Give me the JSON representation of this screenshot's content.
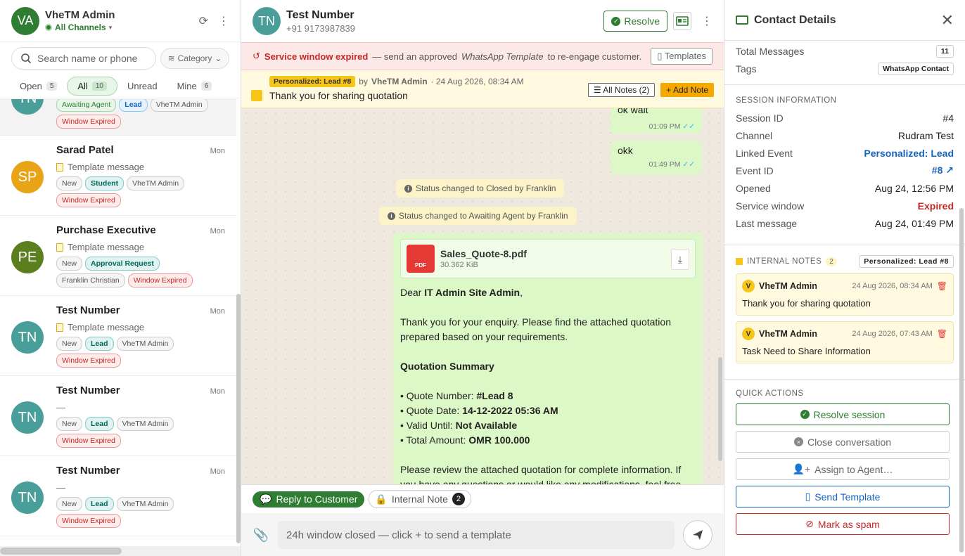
{
  "user": {
    "initials": "VA",
    "name": "VheTM Admin",
    "channel": "All Channels"
  },
  "search": {
    "placeholder": "Search name or phone",
    "category": "Category"
  },
  "tabs": [
    {
      "label": "Open",
      "count": "5"
    },
    {
      "label": "All",
      "count": "10"
    },
    {
      "label": "Unread",
      "count": ""
    },
    {
      "label": "Mine",
      "count": "6"
    }
  ],
  "conversations": [
    {
      "initials": "TN",
      "color": "#4a9e9a",
      "name": "",
      "time": "",
      "preview": "",
      "chips": [
        {
          "t": "Awaiting Agent"
        },
        {
          "t": "Lead"
        },
        {
          "t": "VheTM Admin"
        },
        {
          "t": "Window Expired"
        }
      ]
    },
    {
      "initials": "SP",
      "color": "#e8a317",
      "name": "Sarad Patel",
      "time": "Mon",
      "preview": "Template message",
      "chips": [
        {
          "t": "New"
        },
        {
          "t": "Student"
        },
        {
          "t": "VheTM Admin"
        },
        {
          "t": "Window Expired"
        }
      ]
    },
    {
      "initials": "PE",
      "color": "#5b7f1e",
      "name": "Purchase Executive",
      "time": "Mon",
      "preview": "Template message",
      "chips": [
        {
          "t": "New"
        },
        {
          "t": "Approval Request"
        },
        {
          "t": "Franklin Christian"
        },
        {
          "t": "Window Expired"
        }
      ]
    },
    {
      "initials": "TN",
      "color": "#4a9e9a",
      "name": "Test Number",
      "time": "Mon",
      "preview": "Template message",
      "chips": [
        {
          "t": "New"
        },
        {
          "t": "Lead"
        },
        {
          "t": "VheTM Admin"
        },
        {
          "t": "Window Expired"
        }
      ]
    },
    {
      "initials": "TN",
      "color": "#4a9e9a",
      "name": "Test Number",
      "time": "Mon",
      "preview": "—",
      "chips": [
        {
          "t": "New"
        },
        {
          "t": "Lead"
        },
        {
          "t": "VheTM Admin"
        },
        {
          "t": "Window Expired"
        }
      ]
    },
    {
      "initials": "TN",
      "color": "#4a9e9a",
      "name": "Test Number",
      "time": "Mon",
      "preview": "—",
      "chips": [
        {
          "t": "New"
        },
        {
          "t": "Lead"
        },
        {
          "t": "VheTM Admin"
        },
        {
          "t": "Window Expired"
        }
      ]
    }
  ],
  "contact": {
    "initials": "TN",
    "name": "Test Number",
    "phone": "+91 9173987839",
    "resolve": "Resolve"
  },
  "banner": {
    "title": "Service window expired",
    "text": " — send an approved ",
    "italic": "WhatsApp Template",
    "text2": " to re-engage customer.",
    "button": "Templates"
  },
  "note": {
    "tag": "Personalized: Lead #8",
    "by": "by",
    "author": "VheTM Admin",
    "date": "· 24 Aug 2026, 08:34 AM",
    "text": "Thank you for sharing quotation",
    "all_notes": "All Notes (2)",
    "add_note": "+ Add Note"
  },
  "messages": {
    "m1": {
      "text": "ok wait",
      "time": "01:09 PM"
    },
    "m2": {
      "text": "okk",
      "time": "01:49 PM"
    },
    "sys1": "Status changed to Closed by Franklin",
    "sys2": "Status changed to Awaiting Agent by Franklin",
    "pdf": {
      "name": "Sales_Quote-8.pdf",
      "size": "30.362 KiB",
      "icon_label": "PDF"
    },
    "body": {
      "greet": "Dear ",
      "greet_name": "IT Admin Site Admin",
      "p1": "Thank you for your enquiry. Please find the attached quotation prepared based on your requirements.",
      "summary": "Quotation Summary",
      "l1": "• Quote Number: ",
      "v1": "#Lead 8",
      "l2": "• Quote Date: ",
      "v2": "14-12-2022 05:36 AM",
      "l3": "• Valid Until: ",
      "v3": "Not Available",
      "l4": "• Total Amount: ",
      "v4": "OMR 100.000",
      "p2": "Please review the attached quotation for complete information. If you have any questions or would like any modifications, feel free"
    }
  },
  "composer": {
    "reply": "Reply to Customer",
    "internal": "Internal Note",
    "internal_count": "2",
    "placeholder": "24h window closed — click + to send a template"
  },
  "details": {
    "title": "Contact Details",
    "total_label": "Total Messages",
    "total": "11",
    "tags_label": "Tags",
    "tag": "WhatsApp Contact",
    "session_title": "SESSION INFORMATION",
    "session": [
      {
        "k": "Session ID",
        "v": "#4"
      },
      {
        "k": "Channel",
        "v": "Rudram Test"
      },
      {
        "k": "Linked Event",
        "v": "Personalized: Lead"
      },
      {
        "k": "Event ID",
        "v": "#8"
      },
      {
        "k": "Opened",
        "v": "Aug 24, 12:56 PM"
      },
      {
        "k": "Service window",
        "v": "Expired"
      },
      {
        "k": "Last message",
        "v": "Aug 24, 01:49 PM"
      }
    ],
    "notes_title": "INTERNAL NOTES",
    "notes_count": "2",
    "notes_tag": "Personalized: Lead #8",
    "notes": [
      {
        "av": "V",
        "name": "VheTM Admin",
        "date": "24 Aug 2026, 08:34 AM",
        "text": "Thank you for sharing quotation"
      },
      {
        "av": "V",
        "name": "VheTM Admin",
        "date": "24 Aug 2026, 07:43 AM",
        "text": "Task Need to Share Information"
      }
    ],
    "qa_title": "QUICK ACTIONS",
    "qa": [
      "Resolve session",
      "Close conversation",
      "Assign to Agent…",
      "Send Template",
      "Mark as spam"
    ]
  },
  "colors": {
    "accent": "#2e7d32",
    "danger": "#c62828",
    "link": "#1565c0",
    "note": "#f5c518"
  }
}
